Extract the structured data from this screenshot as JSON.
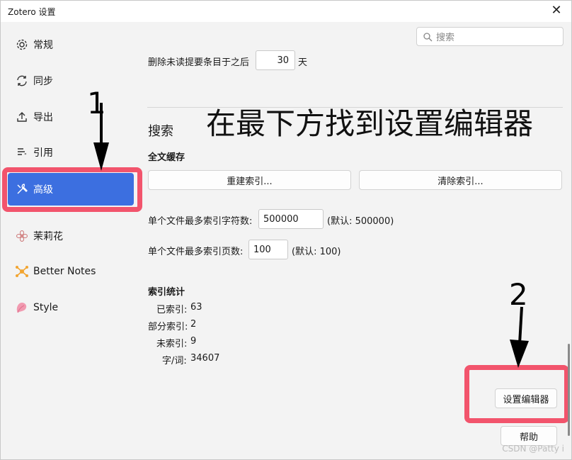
{
  "window": {
    "title": "Zotero 设置",
    "close": "✕"
  },
  "search": {
    "placeholder": "搜索"
  },
  "sidebar": {
    "items": [
      {
        "label": "常规"
      },
      {
        "label": "同步"
      },
      {
        "label": "导出"
      },
      {
        "label": "引用"
      },
      {
        "label": "高级"
      },
      {
        "label": "茉莉花"
      },
      {
        "label": "Better Notes"
      },
      {
        "label": "Style"
      }
    ]
  },
  "main": {
    "delete_unread_label": "删除未读提要条目于之后",
    "delete_unread_value": "30",
    "delete_unread_unit": "天",
    "search_heading": "搜索",
    "fulltext_heading": "全文缓存",
    "rebuild_index": "重建索引...",
    "clear_index": "清除索引...",
    "max_chars_label": "单个文件最多索引字符数:",
    "max_chars_value": "500000",
    "max_chars_default": "(默认: 500000)",
    "max_pages_label": "单个文件最多索引页数:",
    "max_pages_value": "100",
    "max_pages_default": "(默认: 100)",
    "stats_heading": "索引统计",
    "stats": [
      {
        "label": "已索引:",
        "value": "63"
      },
      {
        "label": "部分索引:",
        "value": "2"
      },
      {
        "label": "未索引:",
        "value": "9"
      },
      {
        "label": "字/词:",
        "value": "34607"
      }
    ],
    "config_editor": "设置编辑器",
    "help": "帮助"
  },
  "annotations": {
    "overlay_text": "在最下方找到设置编辑器",
    "step1": "1",
    "step2": "2",
    "watermark": "CSDN @Patty i"
  },
  "colors": {
    "accent": "#3c6fe0",
    "highlight": "#f2546c"
  }
}
